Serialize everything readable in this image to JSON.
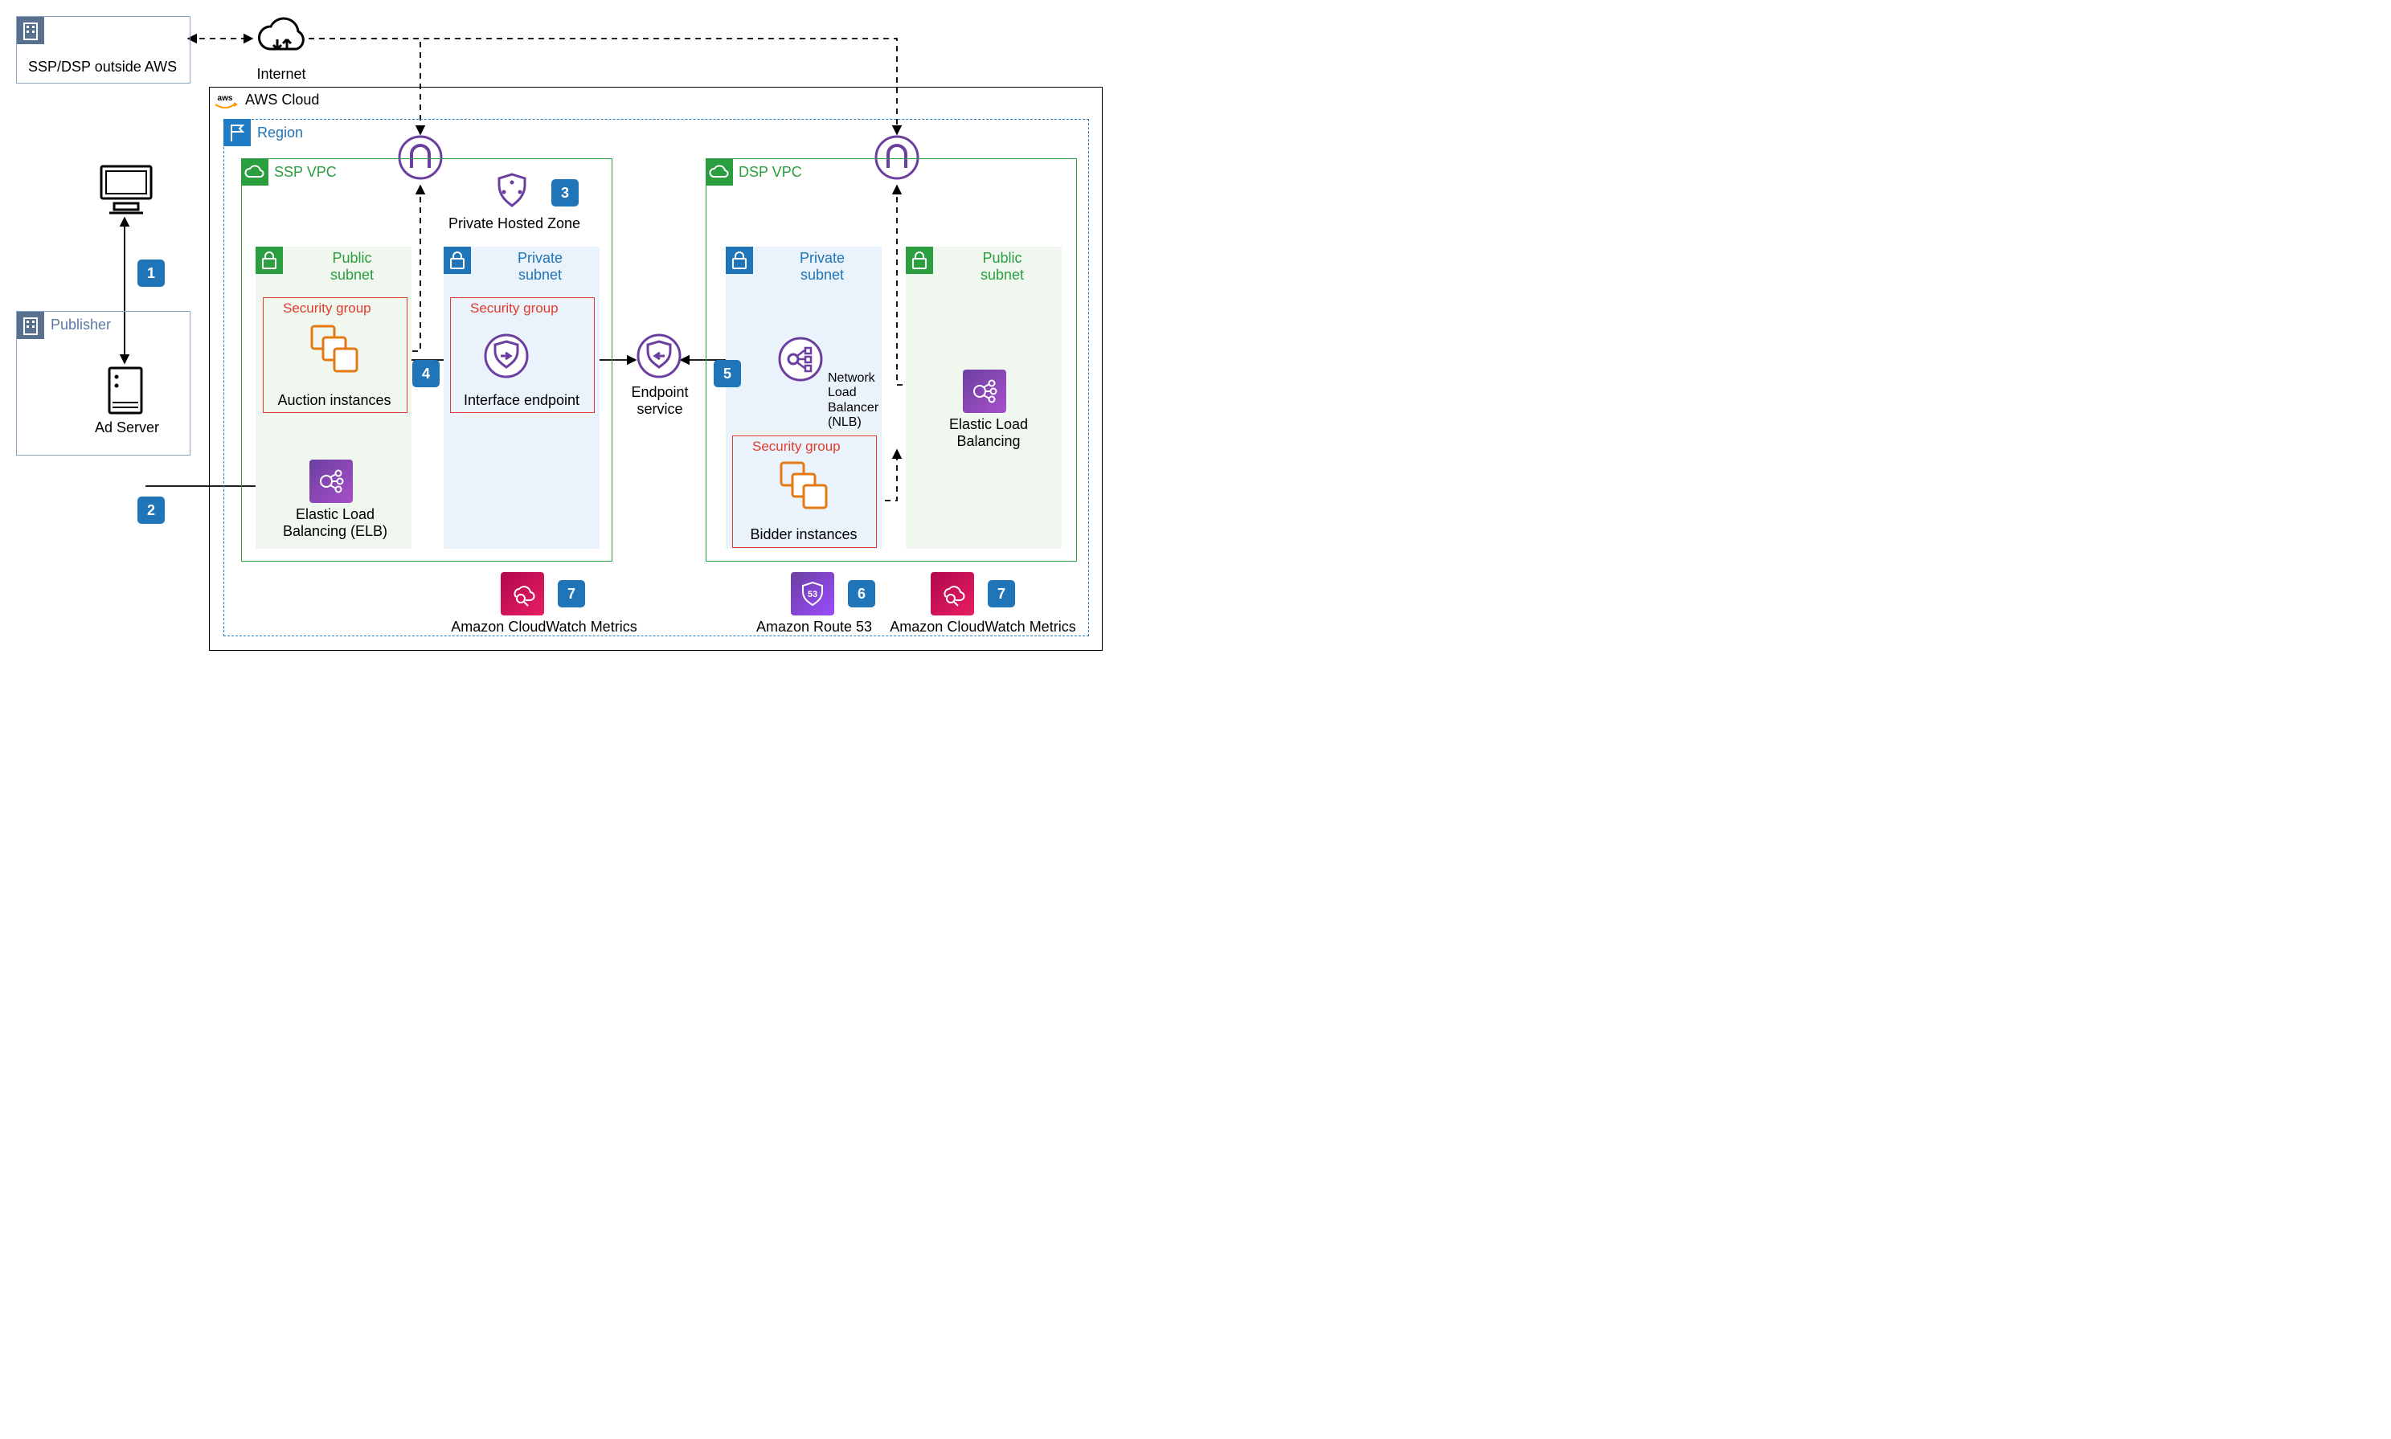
{
  "external": {
    "ssp_dsp_outside": "SSP/DSP outside AWS",
    "internet": "Internet",
    "publisher": "Publisher",
    "ad_server": "Ad Server"
  },
  "aws": {
    "cloud": "AWS Cloud",
    "region": "Region"
  },
  "ssp_vpc": {
    "title": "SSP VPC",
    "public_subnet": "Public\nsubnet",
    "private_subnet": "Private\nsubnet",
    "security_group": "Security group",
    "auction_instances": "Auction instances",
    "elb": "Elastic Load\nBalancing (ELB)",
    "interface_endpoint": "Interface endpoint",
    "private_hosted_zone": "Private Hosted Zone"
  },
  "middle": {
    "endpoint_service": "Endpoint\nservice"
  },
  "dsp_vpc": {
    "title": "DSP VPC",
    "public_subnet": "Public\nsubnet",
    "private_subnet": "Private\nsubnet",
    "security_group": "Security group",
    "bidder_instances": "Bidder instances",
    "nlb": "Network\nLoad\nBalancer\n(NLB)",
    "elb": "Elastic Load\nBalancing"
  },
  "bottom": {
    "cloudwatch_metrics": "Amazon CloudWatch Metrics",
    "route53": "Amazon Route 53"
  },
  "steps": {
    "1": "1",
    "2": "2",
    "3": "3",
    "4": "4",
    "5": "5",
    "6": "6",
    "7": "7"
  }
}
